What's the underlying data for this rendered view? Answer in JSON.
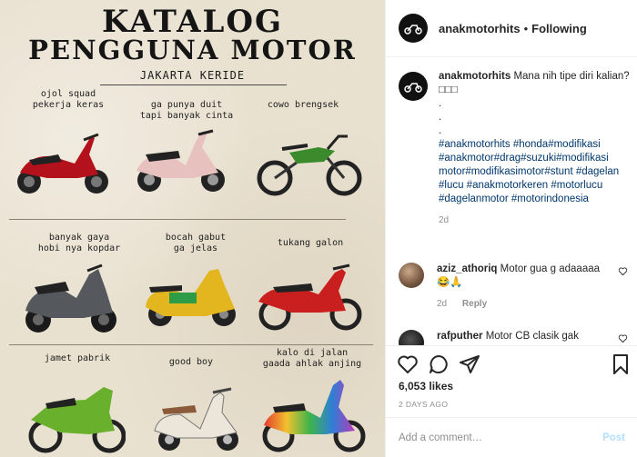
{
  "post": {
    "image": {
      "title_line1": "KATALOG",
      "title_line2": "PENGGUNA MOTOR",
      "subtitle": "JAKARTA KERIDE",
      "cells": [
        {
          "label": "ojol squad\npekerja keras",
          "bike": "red-scooter"
        },
        {
          "label": "ga punya duit\ntapi banyak cinta",
          "bike": "pink-scooter"
        },
        {
          "label": "cowo brengsek",
          "bike": "green-dirt-bike"
        },
        {
          "label": "banyak gaya\nhobi nya kopdar",
          "bike": "grey-maxi-scooter"
        },
        {
          "label": "bocah gabut\nga jelas",
          "bike": "yellow-electric-scooter"
        },
        {
          "label": "tukang galon",
          "bike": "red-underbone"
        },
        {
          "label": "jamet pabrik",
          "bike": "green-sport-bike"
        },
        {
          "label": "good boy",
          "bike": "white-vespa"
        },
        {
          "label": "kalo di jalan\ngaada ahlak anjing",
          "bike": "rainbow-custom-bike"
        }
      ]
    }
  },
  "header": {
    "username": "anakmotorhits",
    "separator": "•",
    "follow_status": "Following"
  },
  "caption": {
    "username": "anakmotorhits",
    "text": "Mana nih tipe diri kalian? □□□",
    "dots": [
      ".",
      ".",
      "."
    ],
    "hashtags": "#anakmotorhits #honda#modifikasi #anakmotor#drag#suzuki#modifikasi motor#modifikasimotor#stunt #dagelan #lucu #anakmotorkeren #motorlucu #dagelanmotor #motorindonesia",
    "time": "2d"
  },
  "comments": [
    {
      "username": "aziz_athoriq",
      "text": "Motor gua g adaaaaa😂🙏",
      "time": "2d",
      "reply_label": "Reply"
    },
    {
      "username": "rafputher",
      "text": "Motor CB clasik gak",
      "time": "",
      "reply_label": ""
    }
  ],
  "likes": "6,053 likes",
  "date": "2 DAYS AGO",
  "add_comment": {
    "placeholder": "Add a comment…",
    "post_label": "Post"
  },
  "icons": {
    "like": "heart-icon",
    "comment": "comment-icon",
    "share": "share-icon",
    "save": "bookmark-icon"
  },
  "colors": {
    "hashtag": "#00376b",
    "muted": "#8e8e8e",
    "post_button": "#b2dffc"
  }
}
